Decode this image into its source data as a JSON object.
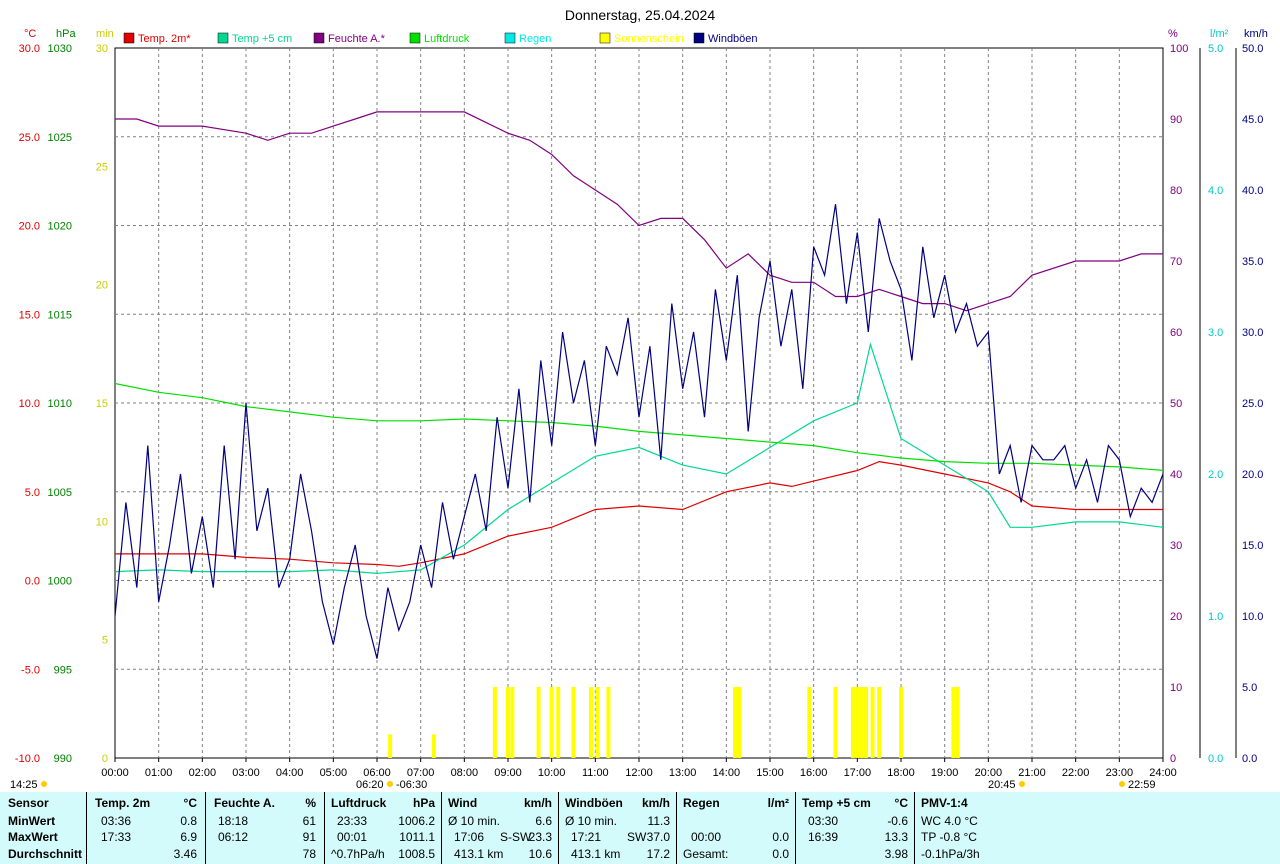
{
  "title": "Donnerstag, 25.04.2024",
  "legend": [
    {
      "label": "Temp. 2m*",
      "color": "#e00000"
    },
    {
      "label": "Temp +5 cm",
      "color": "#00d890"
    },
    {
      "label": "Feuchte A.*",
      "color": "#800080"
    },
    {
      "label": "Luftdruck",
      "color": "#00e000"
    },
    {
      "label": "Regen",
      "color": "#00e8e8"
    },
    {
      "label": "Sonnenschein",
      "color": "#ffff00"
    },
    {
      "label": "Windböen",
      "color": "#000080"
    }
  ],
  "left_axis_units": {
    "temp": "°C",
    "pressure": "hPa",
    "sun": "min"
  },
  "right_axis_units": {
    "humidity": "%",
    "rain": "l/m²",
    "wind": "km/h"
  },
  "bottom_labels": {
    "sunrise_left": "14:25",
    "sunrise": "06:20",
    "sunset_marker": "-06:30",
    "sunset": "20:45",
    "moon": "22:59"
  },
  "chart_data": {
    "type": "line",
    "x_ticks": [
      "00:00",
      "01:00",
      "02:00",
      "03:00",
      "04:00",
      "05:00",
      "06:00",
      "07:00",
      "08:00",
      "09:00",
      "10:00",
      "11:00",
      "12:00",
      "13:00",
      "14:00",
      "15:00",
      "16:00",
      "17:00",
      "18:00",
      "19:00",
      "20:00",
      "21:00",
      "22:00",
      "23:00",
      "24:00"
    ],
    "x_range": [
      0,
      24
    ],
    "axes": {
      "temp": {
        "label": "°C",
        "range": [
          -10,
          30
        ],
        "ticks": [
          "-10.0",
          "-5.0",
          "0.0",
          "5.0",
          "10.0",
          "15.0",
          "20.0",
          "25.0",
          "30.0"
        ],
        "color": "#e00000"
      },
      "pressure": {
        "label": "hPa",
        "range": [
          990,
          1030
        ],
        "ticks": [
          "990",
          "995",
          "1000",
          "1005",
          "1010",
          "1015",
          "1020",
          "1025",
          "1030"
        ],
        "color": "#008000"
      },
      "sun": {
        "label": "min",
        "range": [
          0,
          30
        ],
        "ticks": [
          "0",
          "5",
          "10",
          "15",
          "20",
          "25",
          "30"
        ],
        "color": "#cccc00"
      },
      "humidity": {
        "label": "%",
        "range": [
          0,
          100
        ],
        "ticks": [
          "0",
          "10",
          "20",
          "30",
          "40",
          "50",
          "60",
          "70",
          "80",
          "90",
          "100"
        ],
        "color": "#800080"
      },
      "rain": {
        "label": "l/m²",
        "range": [
          0,
          5
        ],
        "ticks": [
          "0.0",
          "1.0",
          "2.0",
          "3.0",
          "4.0",
          "5.0"
        ],
        "color": "#00c8c8"
      },
      "wind": {
        "label": "km/h",
        "range": [
          0,
          50
        ],
        "ticks": [
          "0.0",
          "5.0",
          "10.0",
          "15.0",
          "20.0",
          "25.0",
          "30.0",
          "35.0",
          "40.0",
          "45.0",
          "50.0"
        ],
        "color": "#000080"
      }
    },
    "series": [
      {
        "name": "Temp. 2m*",
        "axis": "temp",
        "color": "#e00000",
        "x": [
          0,
          1,
          2,
          3,
          4,
          5,
          6,
          6.5,
          7,
          8,
          9,
          10,
          11,
          12,
          13,
          14,
          15,
          15.5,
          16,
          17,
          17.5,
          18,
          19,
          20,
          20.5,
          21,
          22,
          23,
          24
        ],
        "y": [
          1.5,
          1.5,
          1.5,
          1.3,
          1.2,
          1.0,
          0.9,
          0.8,
          1.0,
          1.5,
          2.5,
          3.0,
          4.0,
          4.2,
          4.0,
          5.0,
          5.5,
          5.3,
          5.6,
          6.2,
          6.7,
          6.5,
          6.0,
          5.5,
          5.0,
          4.2,
          4.0,
          4.0,
          4.0
        ]
      },
      {
        "name": "Temp +5 cm",
        "axis": "temp",
        "color": "#00d890",
        "x": [
          0,
          1,
          2,
          3,
          4,
          5,
          6,
          7,
          8,
          9,
          10,
          11,
          12,
          13,
          14,
          15,
          16,
          17,
          17.3,
          18,
          19,
          20,
          20.5,
          21,
          22,
          23,
          24
        ],
        "y": [
          0.5,
          0.6,
          0.5,
          0.5,
          0.5,
          0.6,
          0.4,
          0.6,
          2.0,
          4.0,
          5.5,
          7.0,
          7.5,
          6.5,
          6.0,
          7.5,
          9.0,
          10.0,
          13.3,
          8.0,
          6.5,
          5.0,
          3.0,
          3.0,
          3.3,
          3.3,
          3.0
        ]
      },
      {
        "name": "Feuchte A.*",
        "axis": "humidity",
        "color": "#800080",
        "x": [
          0,
          0.5,
          1,
          2,
          3,
          3.5,
          4,
          4.5,
          5,
          5.5,
          6,
          7,
          8,
          9,
          9.5,
          10,
          10.5,
          11,
          11.5,
          12,
          12.5,
          13,
          13.5,
          14,
          14.5,
          15,
          15.5,
          16,
          16.5,
          17,
          17.5,
          18,
          18.5,
          19,
          19.5,
          20,
          20.5,
          21,
          22,
          23,
          23.5,
          24
        ],
        "y": [
          90,
          90,
          89,
          89,
          88,
          87,
          88,
          88,
          89,
          90,
          91,
          91,
          91,
          88,
          87,
          85,
          82,
          80,
          78,
          75,
          76,
          76,
          73,
          69,
          71,
          68,
          67,
          67,
          65,
          65,
          66,
          65,
          64,
          64,
          63,
          64,
          65,
          68,
          70,
          70,
          71,
          71
        ]
      },
      {
        "name": "Luftdruck",
        "axis": "pressure",
        "color": "#00e000",
        "x": [
          0,
          1,
          2,
          3,
          4,
          5,
          6,
          7,
          8,
          9,
          10,
          11,
          12,
          13,
          14,
          15,
          16,
          17,
          18,
          19,
          20,
          21,
          22,
          23,
          24
        ],
        "y": [
          1011.1,
          1010.6,
          1010.3,
          1009.8,
          1009.5,
          1009.2,
          1009.0,
          1009.0,
          1009.1,
          1009.0,
          1008.9,
          1008.7,
          1008.4,
          1008.2,
          1008.0,
          1007.8,
          1007.6,
          1007.2,
          1006.9,
          1006.7,
          1006.6,
          1006.6,
          1006.5,
          1006.4,
          1006.2
        ]
      },
      {
        "name": "Windböen",
        "axis": "wind",
        "color": "#000080",
        "x": [
          0,
          0.25,
          0.5,
          0.75,
          1,
          1.25,
          1.5,
          1.75,
          2,
          2.25,
          2.5,
          2.75,
          3,
          3.25,
          3.5,
          3.75,
          4,
          4.25,
          4.5,
          4.75,
          5,
          5.25,
          5.5,
          5.75,
          6,
          6.25,
          6.5,
          6.75,
          7,
          7.25,
          7.5,
          7.75,
          8,
          8.25,
          8.5,
          8.75,
          9,
          9.25,
          9.5,
          9.75,
          10,
          10.25,
          10.5,
          10.75,
          11,
          11.25,
          11.5,
          11.75,
          12,
          12.25,
          12.5,
          12.75,
          13,
          13.25,
          13.5,
          13.75,
          14,
          14.25,
          14.5,
          14.75,
          15,
          15.25,
          15.5,
          15.75,
          16,
          16.25,
          16.5,
          16.75,
          17,
          17.25,
          17.5,
          17.75,
          18,
          18.25,
          18.5,
          18.75,
          19,
          19.25,
          19.5,
          19.75,
          20,
          20.25,
          20.5,
          20.75,
          21,
          21.25,
          21.5,
          21.75,
          22,
          22.25,
          22.5,
          22.75,
          23,
          23.25,
          23.5,
          23.75,
          24
        ],
        "y": [
          10,
          18,
          12,
          22,
          11,
          15,
          20,
          13,
          17,
          12,
          22,
          14,
          25,
          16,
          19,
          12,
          14,
          20,
          16,
          11,
          8,
          12,
          15,
          10,
          7,
          12,
          9,
          11,
          15,
          12,
          18,
          14,
          17,
          20,
          16,
          24,
          19,
          26,
          18,
          28,
          22,
          30,
          25,
          28,
          22,
          29,
          27,
          31,
          24,
          29,
          21,
          32,
          26,
          30,
          24,
          33,
          28,
          34,
          23,
          31,
          35,
          29,
          33,
          26,
          36,
          34,
          39,
          32,
          37,
          30,
          38,
          35,
          33,
          28,
          36,
          31,
          34,
          30,
          32,
          29,
          30,
          20,
          22,
          18,
          22,
          21,
          21,
          22,
          19,
          21,
          18,
          22,
          21,
          17,
          19,
          18,
          20
        ]
      }
    ],
    "sunshine_bars": [
      {
        "x": 6.3,
        "min": 1
      },
      {
        "x": 7.3,
        "min": 1
      },
      {
        "x": 8.7,
        "min": 3
      },
      {
        "x": 9.0,
        "min": 3
      },
      {
        "x": 9.1,
        "min": 3
      },
      {
        "x": 9.7,
        "min": 3
      },
      {
        "x": 10.0,
        "min": 3
      },
      {
        "x": 10.15,
        "min": 3
      },
      {
        "x": 10.5,
        "min": 3
      },
      {
        "x": 10.9,
        "min": 3
      },
      {
        "x": 11.05,
        "min": 3
      },
      {
        "x": 11.3,
        "min": 3
      },
      {
        "x": 14.2,
        "min": 3
      },
      {
        "x": 14.3,
        "min": 3
      },
      {
        "x": 15.9,
        "min": 3
      },
      {
        "x": 16.5,
        "min": 3
      },
      {
        "x": 16.9,
        "min": 3
      },
      {
        "x": 17.0,
        "min": 3
      },
      {
        "x": 17.1,
        "min": 3
      },
      {
        "x": 17.2,
        "min": 3
      },
      {
        "x": 17.35,
        "min": 3
      },
      {
        "x": 17.5,
        "min": 3
      },
      {
        "x": 18.0,
        "min": 3
      },
      {
        "x": 19.2,
        "min": 3
      },
      {
        "x": 19.3,
        "min": 3
      }
    ]
  },
  "stats": {
    "sensor": {
      "header": "Sensor",
      "rows": [
        "MinWert",
        "MaxWert",
        "Durchschnitt"
      ]
    },
    "temp2m": {
      "header": "Temp. 2m",
      "unit": "°C",
      "min_time": "03:36",
      "min": "0.8",
      "max_time": "17:33",
      "max": "6.9",
      "avg": "3.46"
    },
    "feuchte": {
      "header": "Feuchte A.",
      "unit": "%",
      "min_time": "18:18",
      "min": "61",
      "max_time": "06:12",
      "max": "91",
      "avg": "78"
    },
    "luftdruck": {
      "header": "Luftdruck",
      "unit": "hPa",
      "min_time": "23:33",
      "min": "1006.2",
      "max_time": "00:01",
      "max": "1011.1",
      "trend": "^0.7hPa/h",
      "avg": "1008.5"
    },
    "wind": {
      "header": "Wind",
      "unit": "km/h",
      "r1_label": "Ø 10 min.",
      "r1_val": "6.6",
      "r2_time": "17:06",
      "r2_dir": "S-SW",
      "r2_val": "23.3",
      "r3_dist": "413.1 km",
      "r3_val": "10.6"
    },
    "windboen": {
      "header": "Windböen",
      "unit": "km/h",
      "r1_label": "Ø 10 min.",
      "r1_val": "11.3",
      "r2_time": "17:21",
      "r2_dir": "SW",
      "r2_val": "37.0",
      "r3_dist": "413.1 km",
      "r3_val": "17.2"
    },
    "regen": {
      "header": "Regen",
      "unit": "l/m²",
      "r2_time": "00:00",
      "r2_val": "0.0",
      "r3_label": "Gesamt:",
      "r3_val": "0.0"
    },
    "temp5cm": {
      "header": "Temp +5 cm",
      "unit": "°C",
      "min_time": "03:30",
      "min": "-0.6",
      "max_time": "16:39",
      "max": "13.3",
      "avg": "3.98"
    },
    "pmv": {
      "header": "PMV-1:4",
      "r1": "WC 4.0 °C",
      "r2": "TP -0.8 °C",
      "r3": "-0.1hPa/3h"
    }
  }
}
